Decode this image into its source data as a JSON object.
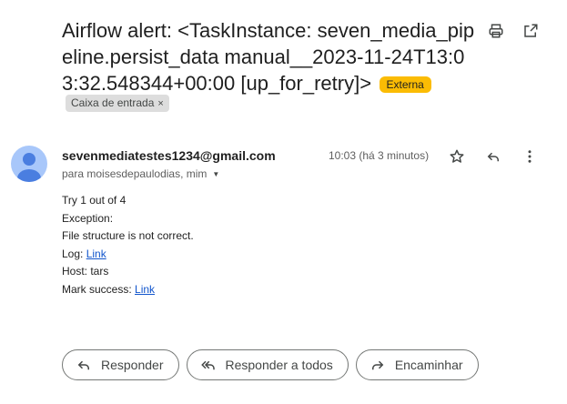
{
  "email": {
    "subject": "Airflow alert: <TaskInstance: seven_media_pipeline.persist_data manual__2023-11-24T13:03:32.548344+00:00 [up_for_retry]>",
    "labels": {
      "external": "Externa",
      "inbox": "Caixa de entrada",
      "inbox_remove": "×"
    },
    "header_icons": [
      "print-icon",
      "open-in-new-window-icon"
    ],
    "sender": {
      "email": "sevenmediatestes1234@gmail.com",
      "recipients": "para moisesdepaulodias, mim",
      "timestamp": "10:03 (há 3 minutos)"
    },
    "sender_action_icons": [
      "star-icon",
      "reply-icon",
      "more-vertical-icon"
    ],
    "body": {
      "line1": "Try 1 out of 4",
      "line2": "Exception:",
      "line3": "File structure is not correct.",
      "log_label": "Log: ",
      "log_link": "Link",
      "host": "Host: tars",
      "mark_label": "Mark success: ",
      "mark_link": "Link"
    }
  },
  "actions": {
    "reply": "Responder",
    "reply_all": "Responder a todos",
    "forward": "Encaminhar"
  },
  "colors": {
    "external_chip": "#fbbc04",
    "inbox_chip": "#dddddd",
    "link": "#1155cc",
    "avatar": "#a8c7fa",
    "avatar_figure": "#4a7ee0"
  }
}
